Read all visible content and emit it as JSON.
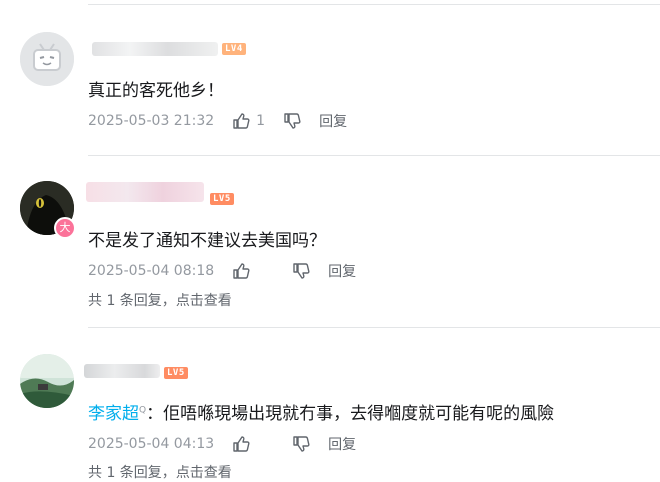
{
  "comments": [
    {
      "level": "LV4",
      "level_color": "#ffb37c",
      "text": "真正的客死他乡！",
      "time": "2025-05-03 21:32",
      "likes": "1",
      "reply_label": "回复"
    },
    {
      "level": "LV5",
      "level_color": "#ff8c62",
      "text": "不是发了通知不建议去美国吗？",
      "time": "2025-05-04 08:18",
      "likes": "",
      "reply_label": "回复",
      "replies_prefix": "共 1 条回复，",
      "replies_link": "点击查看",
      "avatar_badge": "大"
    },
    {
      "level": "LV5",
      "level_color": "#ff8c62",
      "author": "李家超",
      "author_color": "#00aeec",
      "text": "：佢唔喺現場出現就冇事，去得嗰度就可能有呢的風險",
      "time": "2025-05-04 04:13",
      "likes": "",
      "reply_label": "回复",
      "replies_prefix": "共 1 条回复，",
      "replies_link": "点击查看"
    }
  ]
}
